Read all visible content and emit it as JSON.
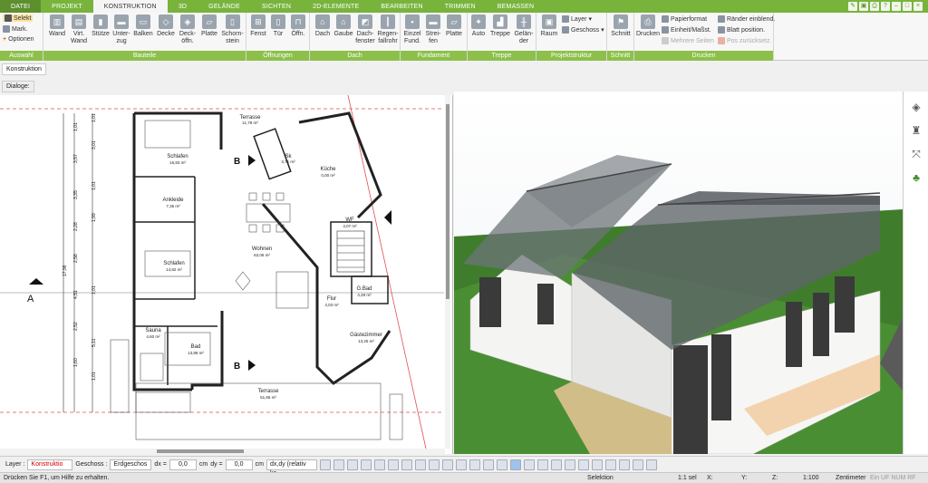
{
  "tabs": [
    "DATEI",
    "PROJEKT",
    "KONSTRUKTION",
    "3D",
    "GELÄNDE",
    "SICHTEN",
    "2D-ELEMENTE",
    "BEARBEITEN",
    "TRIMMEN",
    "BEMASSEN"
  ],
  "active_tab": "KONSTRUKTION",
  "ribbon": {
    "auswahl": {
      "title": "Auswahl",
      "selekt": "Selekt",
      "mark": "Mark.",
      "optionen": "Optionen"
    },
    "bauteile": {
      "title": "Bauteile",
      "buttons": [
        "Wand",
        "Virt. Wand",
        "Stütze",
        "Unter-zug",
        "Balken",
        "Decke",
        "Deck-öffn.",
        "Platte",
        "Schorn-stein"
      ]
    },
    "oeffnungen": {
      "title": "Öffnungen",
      "buttons": [
        "Fenst",
        "Tür",
        "Öffn."
      ]
    },
    "dach": {
      "title": "Dach",
      "buttons": [
        "Dach",
        "Gaube",
        "Dach-fenster",
        "Regen-fallrohr"
      ]
    },
    "fundament": {
      "title": "Fundament",
      "buttons": [
        "Einzel Fund.",
        "Strei-fen",
        "Platte"
      ]
    },
    "treppe": {
      "title": "Treppe",
      "buttons": [
        "Auto",
        "Treppe",
        "Gelän-der"
      ]
    },
    "projektstruktur": {
      "title": "Projektstruktur",
      "buttons": [
        "Raum"
      ],
      "layer": "Layer",
      "geschoss": "Geschoss"
    },
    "schnitt": {
      "title": "Schnitt",
      "buttons": [
        "Schnitt"
      ]
    },
    "drucken": {
      "title": "Drucken",
      "buttons": [
        "Drucken"
      ],
      "papierformat": "Papierformat",
      "einheit": "Einheit/Maßst.",
      "mehrere": "Mehrere Seiten",
      "raender": "Ränder einblend.",
      "blatt": "Blatt position.",
      "pos": "Pos zurücksetz."
    }
  },
  "panel": {
    "konstruktion": "Konstruktion",
    "dialoge": "Dialoge:"
  },
  "plan": {
    "rooms": [
      {
        "name": "Schlafen",
        "area": "16,83 m²"
      },
      {
        "name": "Ankleide",
        "area": "7,35 m²"
      },
      {
        "name": "Schlafen",
        "area": "14,82 m²"
      },
      {
        "name": "Sauna",
        "area": "4,60 m²"
      },
      {
        "name": "Bad",
        "area": "13,88 m²"
      },
      {
        "name": "Wohnen",
        "area": "63,06 m²"
      },
      {
        "name": "Terrasse",
        "area": "11,79 m²"
      },
      {
        "name": "Sk",
        "area": "3,71 m²"
      },
      {
        "name": "Küche",
        "area": "0,00 m²"
      },
      {
        "name": "WF",
        "area": "4,07 m²"
      },
      {
        "name": "G.Bad",
        "area": "4,49 m²"
      },
      {
        "name": "Flur",
        "area": "4,03 m²"
      },
      {
        "name": "Gästezimmer",
        "area": "13,25 m²"
      },
      {
        "name": "Terrasse",
        "area": "51,65 m²"
      }
    ],
    "section_a": "A",
    "section_b": "B",
    "dims": [
      "1,01",
      "1,01",
      "3,57",
      "3,01",
      "3,35",
      "1,01",
      "2,28",
      "1,99",
      "2,58",
      "4,51",
      "1,01",
      "2,52",
      "5,11",
      "1,60",
      "1,01",
      "17,96"
    ]
  },
  "inputbar": {
    "layer_label": "Layer :",
    "layer_value": "Konstruktio",
    "geschoss_label": "Geschoss :",
    "geschoss_value": "Erdgeschos",
    "dx_label": "dx =",
    "dx_value": "0,0",
    "dy_label": "dy =",
    "dy_value": "0,0",
    "unit": "cm",
    "mode": "dx,dy (relativ ka"
  },
  "status": {
    "help": "Drücken Sie F1, um Hilfe zu erhalten.",
    "selektion": "Selektion",
    "scale_sel": "1:1 sel",
    "x": "X:",
    "y": "Y:",
    "z": "Z:",
    "scale": "1:100",
    "unit": "Zentimeter",
    "flags": "Ein  UF  NUM  RF"
  },
  "colors": {
    "accent": "#78b43c",
    "accent_dark": "#5e8f2e",
    "ribbon_title": "#8cc04a"
  }
}
